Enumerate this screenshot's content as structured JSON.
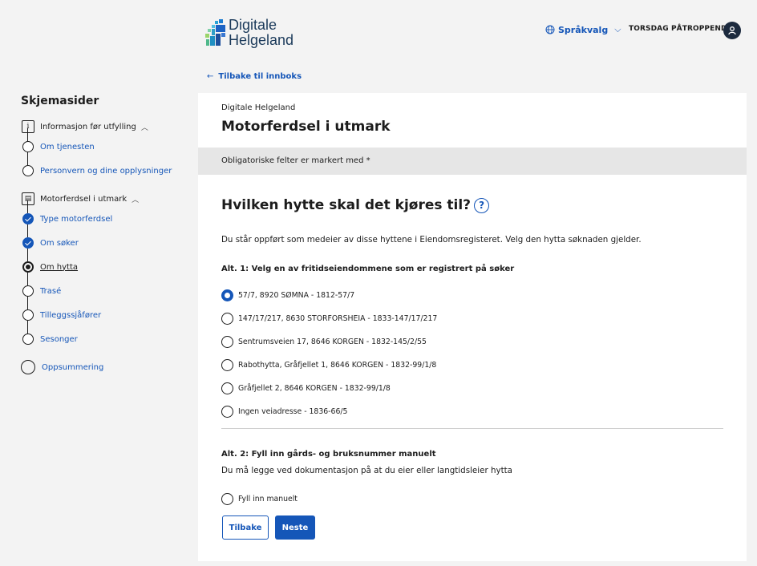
{
  "header": {
    "logo_line1": "Digitale",
    "logo_line2": "Helgeland",
    "language_label": "Språkvalg",
    "user_name": "TORSDAG PÅTROPPENDE"
  },
  "back_link": "Tilbake til innboks",
  "sidebar": {
    "title": "Skjemasider",
    "groups": [
      {
        "icon_text": "i",
        "label": "Informasjon før utfylling",
        "steps": [
          {
            "label": "Om tjenesten",
            "state": "todo"
          },
          {
            "label": "Personvern og dine opplysninger",
            "state": "todo"
          }
        ]
      },
      {
        "icon_text": "▤",
        "label": "Motorferdsel i utmark",
        "steps": [
          {
            "label": "Type motorferdsel",
            "state": "done"
          },
          {
            "label": "Om søker",
            "state": "done"
          },
          {
            "label": "Om hytta",
            "state": "current"
          },
          {
            "label": "Trasé",
            "state": "todo"
          },
          {
            "label": "Tilleggssjåfører",
            "state": "todo"
          },
          {
            "label": "Sesonger",
            "state": "todo"
          }
        ]
      }
    ],
    "summary": "Oppsummering"
  },
  "form": {
    "org": "Digitale Helgeland",
    "title": "Motorferdsel i utmark",
    "mandatory_note": "Obligatoriske felter er markert med *",
    "question": "Hvilken hytte skal det kjøres til?",
    "description": "Du står oppført som medeier av disse hyttene i Eiendomsregisteret. Velg den hytta søknaden gjelder.",
    "alt1_heading": "Alt. 1: Velg en av fritidseiendommene som er registrert på søker",
    "options": [
      "57/7, 8920 SØMNA - 1812-57/7",
      "147/17/217, 8630 STORFORSHEIA - 1833-147/17/217",
      "Sentrumsveien 17, 8646 KORGEN - 1832-145/2/55",
      "Rabothytta, Gråfjellet 1, 8646 KORGEN - 1832-99/1/8",
      "Gråfjellet 2, 8646 KORGEN - 1832-99/1/8",
      "Ingen veiadresse - 1836-66/5"
    ],
    "selected_option": "57/7, 8920 SØMNA - 1812-57/7",
    "alt2_heading": "Alt. 2: Fyll inn gårds- og bruksnummer manuelt",
    "alt2_description": "Du må legge ved dokumentasjon på at du eier eller langtidsleier hytta",
    "manual_option": "Fyll inn manuelt",
    "back_button": "Tilbake",
    "next_button": "Neste"
  },
  "colors": {
    "primary": "#1556b8",
    "background": "#f3f3f3",
    "card": "#ffffff",
    "mandatory_bar": "#e6e6e6"
  }
}
